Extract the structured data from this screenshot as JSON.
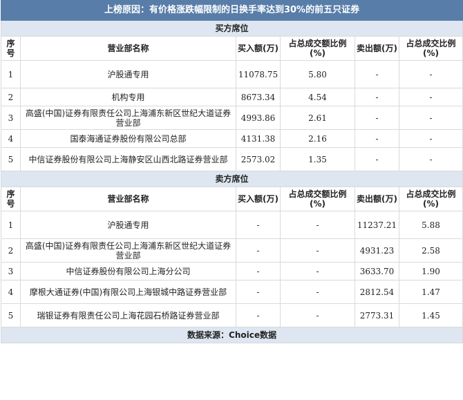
{
  "title": "上榜原因：有价格涨跌幅限制的日换手率达到30%的前五只证券",
  "buy": {
    "section": "买方席位",
    "headers": [
      "序号",
      "营业部名称",
      "买入额(万)",
      "占总成交额比例(%)",
      "卖出额(万)",
      "占总成交比例(%)"
    ],
    "rows": [
      {
        "no": "1",
        "name": "沪股通专用",
        "buy": "11078.75",
        "buy_pct": "5.80",
        "sell": "-",
        "sell_pct": "-"
      },
      {
        "no": "2",
        "name": "机构专用",
        "buy": "8673.34",
        "buy_pct": "4.54",
        "sell": "-",
        "sell_pct": "-"
      },
      {
        "no": "3",
        "name": "高盛(中国)证券有限责任公司上海浦东新区世纪大道证券营业部",
        "buy": "4993.86",
        "buy_pct": "2.61",
        "sell": "-",
        "sell_pct": "-"
      },
      {
        "no": "4",
        "name": "国泰海通证券股份有限公司总部",
        "buy": "4131.38",
        "buy_pct": "2.16",
        "sell": "-",
        "sell_pct": "-"
      },
      {
        "no": "5",
        "name": "中信证券股份有限公司上海静安区山西北路证券营业部",
        "buy": "2573.02",
        "buy_pct": "1.35",
        "sell": "-",
        "sell_pct": "-"
      }
    ]
  },
  "sell": {
    "section": "卖方席位",
    "headers": [
      "序号",
      "营业部名称",
      "买入额(万)",
      "占总成交额比例(%)",
      "卖出额(万)",
      "占总成交比例(%)"
    ],
    "rows": [
      {
        "no": "1",
        "name": "沪股通专用",
        "buy": "-",
        "buy_pct": "-",
        "sell": "11237.21",
        "sell_pct": "5.88"
      },
      {
        "no": "2",
        "name": "高盛(中国)证券有限责任公司上海浦东新区世纪大道证券营业部",
        "buy": "-",
        "buy_pct": "-",
        "sell": "4931.23",
        "sell_pct": "2.58"
      },
      {
        "no": "3",
        "name": "中信证券股份有限公司上海分公司",
        "buy": "-",
        "buy_pct": "-",
        "sell": "3633.70",
        "sell_pct": "1.90"
      },
      {
        "no": "4",
        "name": "摩根大通证券(中国)有限公司上海银城中路证券营业部",
        "buy": "-",
        "buy_pct": "-",
        "sell": "2812.54",
        "sell_pct": "1.47"
      },
      {
        "no": "5",
        "name": "瑞银证券有限责任公司上海花园石桥路证券营业部",
        "buy": "-",
        "buy_pct": "-",
        "sell": "2773.31",
        "sell_pct": "1.45"
      }
    ]
  },
  "footer": "数据来源：Choice数据"
}
